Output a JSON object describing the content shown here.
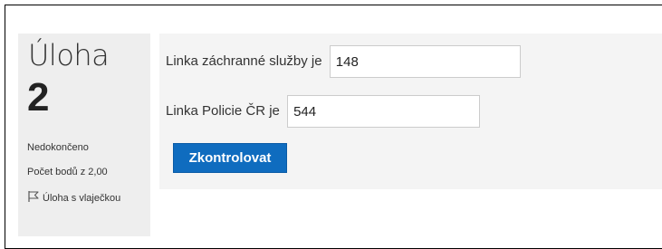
{
  "question_info": {
    "title": "Úloha",
    "number": "2",
    "state": "Nedokončeno",
    "grade": "Počet bodů z 2,00",
    "flag_label": "Úloha s vlaječkou",
    "flag_icon": "flag-icon"
  },
  "question": {
    "row1": {
      "label": "Linka záchranné služby je",
      "value": "148"
    },
    "row2": {
      "label": "Linka Policie  ČR je",
      "value": "544"
    }
  },
  "actions": {
    "check_label": "Zkontrolovat"
  },
  "colors": {
    "info_background": "#eeeeee",
    "content_background": "#f4f4f4",
    "button_background": "#0f6cbf"
  }
}
